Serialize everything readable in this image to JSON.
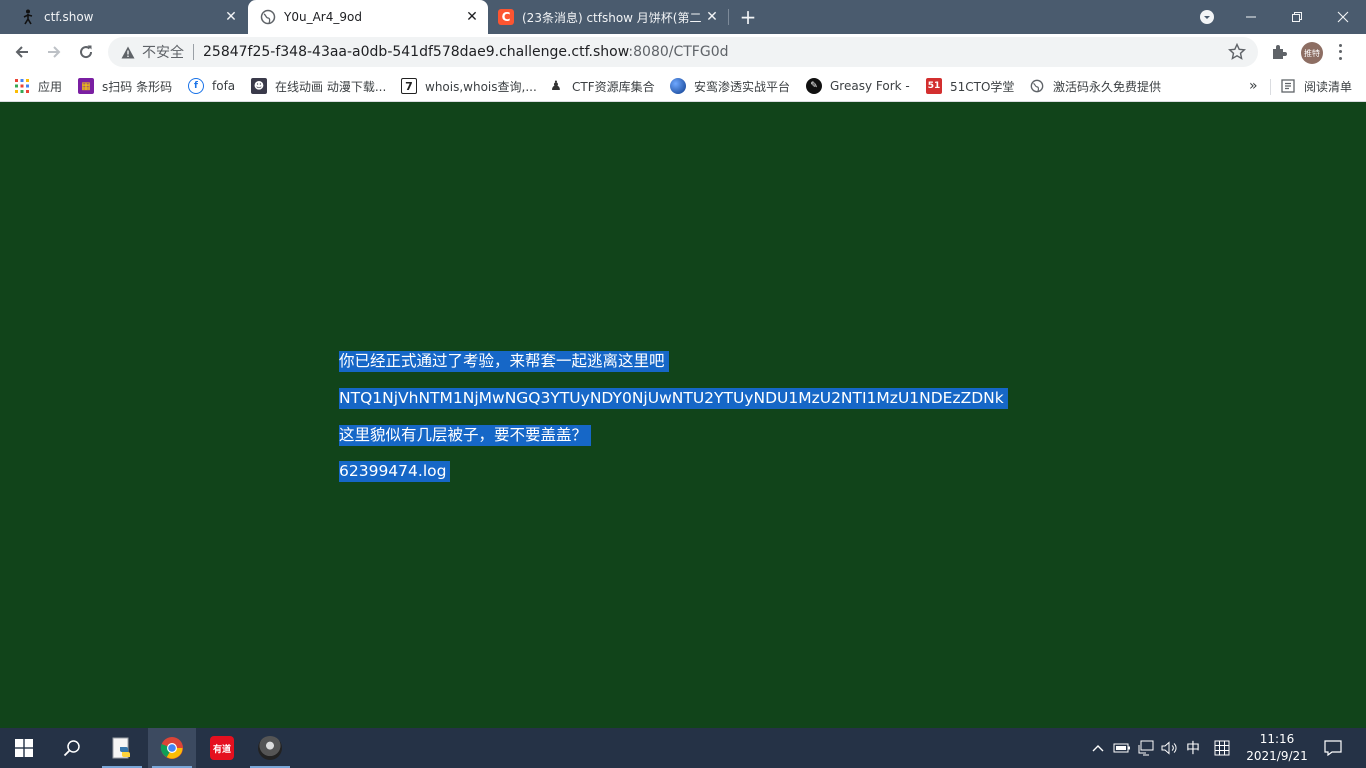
{
  "tabs": [
    {
      "title": "ctf.show",
      "favicon": "stickman-icon",
      "active": false
    },
    {
      "title": "Y0u_Ar4_9od",
      "favicon": "globe-icon",
      "active": true
    },
    {
      "title": "(23条消息) ctfshow 月饼杯(第二",
      "favicon": "csdn-c-icon",
      "active": false
    }
  ],
  "omnibox": {
    "security_label": "不安全",
    "url_host": "25847f25-f348-43aa-a0db-541df578dae9.challenge.ctf.show",
    "url_rest": ":8080/CTFG0d"
  },
  "profile": {
    "avatar_text": "推特"
  },
  "bookmarks": {
    "apps_label": "应用",
    "items": [
      {
        "label": "s扫码 条形码"
      },
      {
        "label": "fofa"
      },
      {
        "label": "在线动画 动漫下载..."
      },
      {
        "label": "whois,whois查询,..."
      },
      {
        "label": "CTF资源库集合"
      },
      {
        "label": "安鸾渗透实战平台"
      },
      {
        "label": "Greasy Fork -"
      },
      {
        "label": "51CTO学堂"
      },
      {
        "label": "激活码永久免费提供"
      }
    ],
    "reading_list": "阅读清单"
  },
  "page": {
    "lines": [
      "你已经正式通过了考验，来帮套一起逃离这里吧",
      "NTQ1NjVhNTM1NjMwNGQ3YTUyNDY0NjUwNTU2YTUyNDU1MzU2NTI1MzU1NDEzZDNk",
      "这里貌似有几层被子，要不要盖盖？",
      "62399474.log"
    ]
  },
  "taskbar": {
    "ime_label": "中",
    "time": "11:16",
    "date": "2021/9/21"
  },
  "colors": {
    "page_bg": "#11441a",
    "selection": "#1667c7",
    "tabstrip": "#4a5b6e",
    "taskbar": "#253246"
  }
}
